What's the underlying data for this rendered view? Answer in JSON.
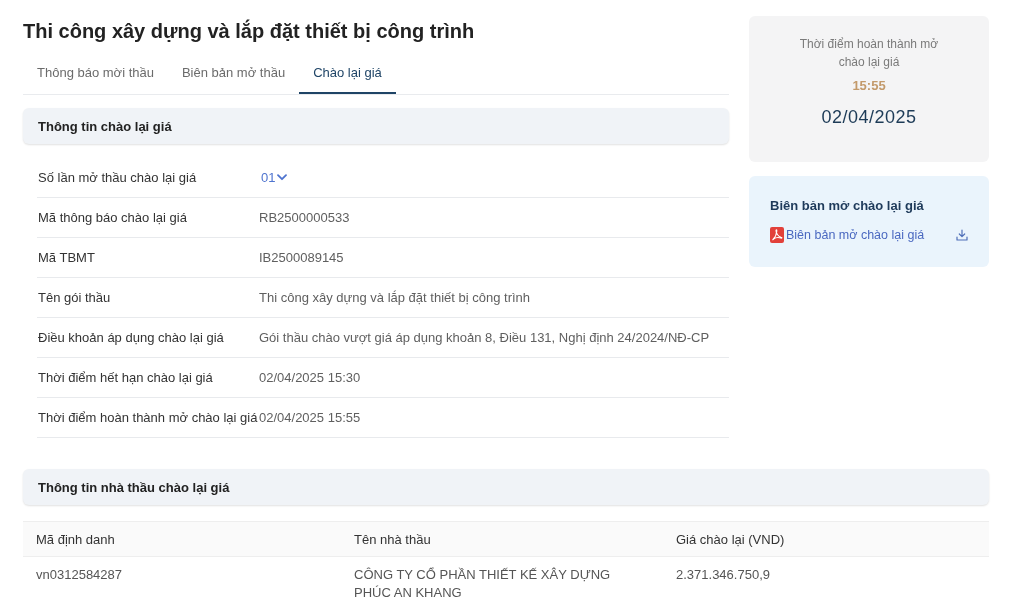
{
  "page": {
    "title": "Thi công xây dựng và lắp đặt thiết bị công trình"
  },
  "tabs": [
    {
      "label": "Thông báo mời thầu",
      "selected": false
    },
    {
      "label": "Biên bản mở thầu",
      "selected": false
    },
    {
      "label": "Chào lại giá",
      "selected": true
    }
  ],
  "info_section": {
    "title": "Thông tin chào lại giá",
    "rows": [
      {
        "kind": "dropdown",
        "label": "Số lần mở thầu chào lại giá",
        "value": "01"
      },
      {
        "kind": "text",
        "label": "Mã thông báo chào lại giá",
        "value": "RB2500000533"
      },
      {
        "kind": "text",
        "label": "Mã TBMT",
        "value": "IB2500089145"
      },
      {
        "kind": "text",
        "label": "Tên gói thầu",
        "value": "Thi công xây dựng và lắp đặt thiết bị công trình"
      },
      {
        "kind": "text",
        "label": "Điều khoản áp dụng chào lại giá",
        "value": "Gói thầu chào vượt giá áp dụng khoản 8, Điều 131, Nghị định 24/2024/NĐ-CP"
      },
      {
        "kind": "text",
        "label": "Thời điểm hết hạn chào lại giá",
        "value": "02/04/2025 15:30"
      },
      {
        "kind": "text",
        "label": "Thời điểm hoàn thành mở chào lại giá",
        "value": "02/04/2025 15:55"
      }
    ]
  },
  "completion_card": {
    "label": "Thời điểm hoàn thành mở chào lại giá",
    "time": "15:55",
    "date": "02/04/2025"
  },
  "minutes_card": {
    "title": "Biên bản mở chào lại giá",
    "files": [
      {
        "name": "Biên bản mở chào lại giá"
      }
    ]
  },
  "bidders_section": {
    "title": "Thông tin nhà thầu chào lại giá",
    "table": {
      "columns": [
        "Mã định danh",
        "Tên nhà thầu",
        "Giá chào lại (VND)"
      ],
      "rows": [
        [
          "vn0312584287",
          "CÔNG TY CỔ PHẦN THIẾT KẾ XÂY DỰNG PHÚC AN KHANG",
          "2.371.346.750,9"
        ]
      ]
    }
  }
}
